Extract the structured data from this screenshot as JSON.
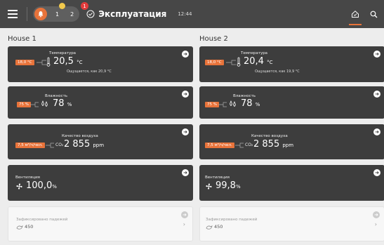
{
  "header": {
    "alarm_count_1": "1",
    "alarm_count_2": "2",
    "red_badge": "1",
    "title": "Эксплуатация",
    "time": "12:44"
  },
  "houses": [
    {
      "name": "House 1",
      "temperature": {
        "label": "Температура",
        "setpoint": "18,0 °C",
        "value": "20,5",
        "unit": "°C",
        "feels": "Ощущается, как 20,9 °C"
      },
      "humidity": {
        "label": "Влажность",
        "setpoint": "75 %",
        "value": "78",
        "unit": "%"
      },
      "air": {
        "label": "Качество воздуха",
        "setpoint": "7,5 м³/ч/чел.",
        "prefix": "CO₂",
        "value": "2 855",
        "unit": "ppm"
      },
      "ventilation": {
        "label": "Вентиляция",
        "value": "100,0",
        "unit": "%"
      },
      "dead": {
        "label": "Зафиксировано падежей",
        "value": "450"
      }
    },
    {
      "name": "House 2",
      "temperature": {
        "label": "Температура",
        "setpoint": "18,0 °C",
        "value": "20,4",
        "unit": "°C",
        "feels": "Ощущается, как 19,9 °C"
      },
      "humidity": {
        "label": "Влажность",
        "setpoint": "75 %",
        "value": "78",
        "unit": "%"
      },
      "air": {
        "label": "Качество воздуха",
        "setpoint": "7,5 м³/ч/чел.",
        "prefix": "CO₂",
        "value": "2 855",
        "unit": "ppm"
      },
      "ventilation": {
        "label": "Вентиляция",
        "value": "99,8",
        "unit": "%"
      },
      "dead": {
        "label": "Зафиксировано падежей",
        "value": "450"
      }
    }
  ],
  "colors": {
    "accent": "#e8733a",
    "card": "#3d3d3d",
    "topbar": "#474747",
    "background": "#ededed"
  },
  "icons": [
    "menu-icon",
    "alarm-icon",
    "mode-icon",
    "home-icon",
    "search-icon",
    "thermometer-icon",
    "humidity-icon",
    "ventilation-icon",
    "dead-bird-icon",
    "arrow-right-icon",
    "chevron-right-icon"
  ]
}
